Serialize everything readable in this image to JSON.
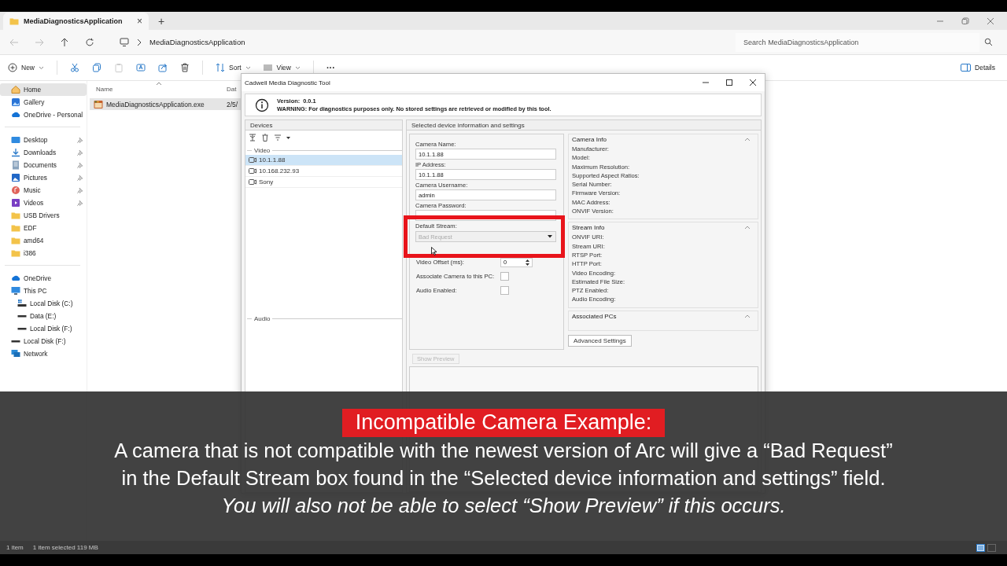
{
  "explorer": {
    "tab": {
      "title": "MediaDiagnosticsApplication",
      "close": "×",
      "new_tab": "+"
    },
    "address": {
      "crumbs": [
        "MediaDiagnosticsApplication"
      ]
    },
    "search": {
      "placeholder": "Search MediaDiagnosticsApplication"
    },
    "toolbar": {
      "new": "New",
      "sort": "Sort",
      "view": "View",
      "more": "···",
      "details": "Details"
    },
    "sidebar": {
      "sections": [
        {
          "items": [
            {
              "label": "Home",
              "kind": "home",
              "selected": true
            },
            {
              "label": "Gallery",
              "kind": "gallery",
              "selected": false
            },
            {
              "label": "OneDrive - Personal",
              "kind": "cloud",
              "selected": false
            }
          ]
        },
        {
          "items": [
            {
              "label": "Desktop",
              "kind": "desktop",
              "pinned": true,
              "selected": false
            },
            {
              "label": "Downloads",
              "kind": "download",
              "pinned": true,
              "selected": false
            },
            {
              "label": "Documents",
              "kind": "document",
              "pinned": true,
              "selected": false
            },
            {
              "label": "Pictures",
              "kind": "pictures",
              "pinned": true,
              "selected": false
            },
            {
              "label": "Music",
              "kind": "music",
              "pinned": true,
              "selected": false
            },
            {
              "label": "Videos",
              "kind": "videos",
              "pinned": true,
              "selected": false
            },
            {
              "label": "USB Drivers",
              "kind": "folder",
              "pinned": false,
              "selected": false
            },
            {
              "label": "EDF",
              "kind": "folder",
              "pinned": false,
              "selected": false
            },
            {
              "label": "amd64",
              "kind": "folder",
              "pinned": false,
              "selected": false
            },
            {
              "label": "i386",
              "kind": "folder",
              "pinned": false,
              "selected": false
            }
          ]
        },
        {
          "items": [
            {
              "label": "OneDrive",
              "kind": "cloud",
              "selected": false
            },
            {
              "label": "This PC",
              "kind": "pc",
              "selected": false,
              "children": [
                {
                  "label": "Local Disk (C:)",
                  "kind": "system-drive",
                  "selected": false
                },
                {
                  "label": "Data (E:)",
                  "kind": "drive",
                  "selected": false
                },
                {
                  "label": "Local Disk (F:)",
                  "kind": "drive",
                  "selected": false
                }
              ]
            },
            {
              "label": "Local Disk (F:)",
              "kind": "drive",
              "selected": false
            },
            {
              "label": "Network",
              "kind": "network",
              "selected": false
            }
          ]
        }
      ]
    },
    "list": {
      "columns": [
        "Name",
        "Dat"
      ],
      "rows": [
        {
          "name": "MediaDiagnosticsApplication.exe",
          "date": "2/5/",
          "selected": true
        }
      ]
    },
    "status_bar": {
      "count": "1 item",
      "selection": "1 item selected  119 MB"
    }
  },
  "dialog": {
    "title": "Cadwell Media Diagnostic Tool",
    "version_label": "Version:",
    "version": "0.0.1",
    "warning": "WARNING: For diagnostics purposes only. No stored settings are retrieved or modified by this tool.",
    "devices": {
      "header": "Devices",
      "groups": [
        {
          "label": "Video",
          "items": [
            {
              "label": "10.1.1.88",
              "selected": true
            },
            {
              "label": "10.168.232.93",
              "selected": false
            },
            {
              "label": "Sony",
              "selected": false
            }
          ]
        },
        {
          "label": "Audio"
        }
      ]
    },
    "settings": {
      "header": "Selected device information and settings",
      "fields": [
        {
          "label": "Camera Name:",
          "kind": "text",
          "value": "10.1.1.88"
        },
        {
          "label": "IP Address:",
          "kind": "text",
          "value": "10.1.1.88"
        },
        {
          "label": "Camera Username:",
          "kind": "text",
          "value": "admin"
        },
        {
          "label": "Camera Password:",
          "kind": "text"
        },
        {
          "label": "Default Stream:",
          "kind": "dropdown",
          "value": "Bad Request",
          "disabled": true
        }
      ],
      "options": [
        {
          "label": "Video Offset (ms):",
          "kind": "spinner",
          "value": "0"
        },
        {
          "label": "Associate Camera to this PC:",
          "kind": "checkbox",
          "checked": false
        },
        {
          "label": "Audio Enabled:",
          "kind": "checkbox",
          "checked": false
        }
      ],
      "info_groups": [
        {
          "title": "Camera Info",
          "fields": [
            "Manufacturer:",
            "Model:",
            "Maximum Resolution:",
            "Supported Aspect Ratios:",
            "Serial Number:",
            "Firmware Version:",
            "MAC Address:",
            "ONVIF Version:"
          ]
        },
        {
          "title": "Stream Info",
          "fields": [
            "ONVIF URI:",
            "Stream URI:",
            "RTSP Port:",
            "HTTP Port:",
            "Video Encoding:",
            "Estimated File Size:",
            "PTZ Enabled:",
            "Audio Encoding:"
          ]
        },
        {
          "title": "Associated PCs"
        }
      ],
      "advanced_button": "Advanced Settings",
      "preview_button": {
        "label": "Show Preview",
        "disabled": true
      }
    }
  },
  "caption": {
    "title": "Incompatible Camera Example:",
    "lines": [
      "A camera that is not compatible with the newest version of Arc will give a “Bad Request”",
      "in the Default Stream box found in the “Selected device information and settings” field."
    ],
    "note": "You will also not be able to select “Show Preview” if this occurs."
  }
}
